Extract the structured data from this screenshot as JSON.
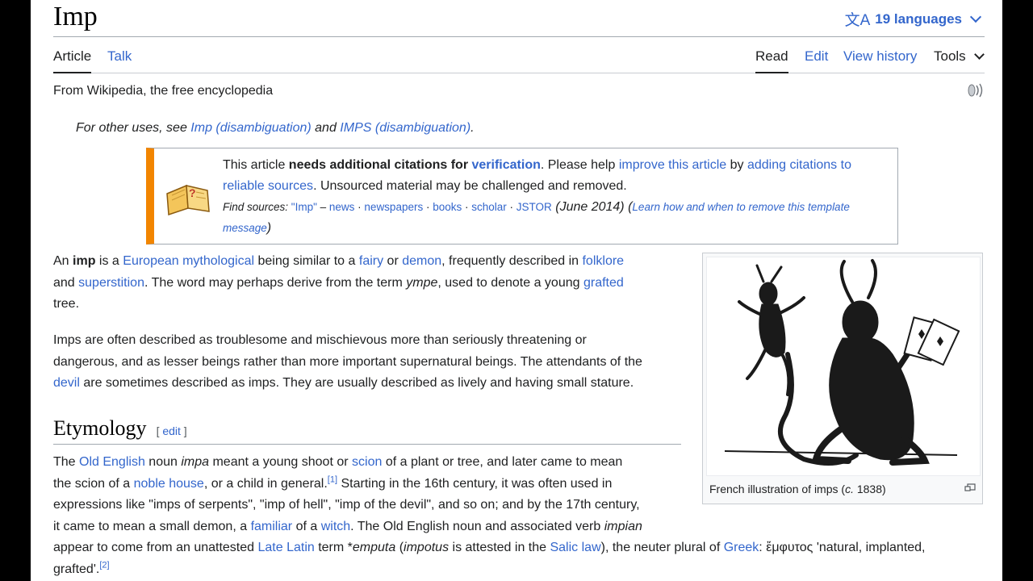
{
  "title": "Imp",
  "languages": "19 languages",
  "tabs": {
    "article": "Article",
    "talk": "Talk",
    "read": "Read",
    "edit": "Edit",
    "history": "View history",
    "tools": "Tools"
  },
  "tagline": "From Wikipedia, the free encyclopedia",
  "hatnote": {
    "prefix": "For other uses, see ",
    "link1": "Imp (disambiguation)",
    "mid": " and ",
    "link2": "IMPS (disambiguation)",
    "suffix": "."
  },
  "ambox": {
    "t1": "This article ",
    "bold": "needs additional citations for ",
    "verif": "verification",
    "t2": ". Please help ",
    "improve": "improve this article",
    "t3": " by ",
    "adding": "adding citations to reliable sources",
    "t4": ". Unsourced material may be challenged and removed.",
    "find": "Find sources: ",
    "q": "\"Imp\"",
    "dash": " – ",
    "news": "news",
    "dot": " · ",
    "newspapers": "newspapers",
    "books": "books",
    "scholar": "scholar",
    "jstor": "JSTOR",
    "date": " (June 2014)",
    "learn_open": " (",
    "learn": "Learn how and when to remove this template message",
    "learn_close": ")"
  },
  "p1": {
    "a": "An ",
    "imp": "imp",
    "b": " is a ",
    "euro": "European mythological",
    "c": " being similar to a ",
    "fairy": "fairy",
    "d": " or ",
    "demon": "demon",
    "e": ", frequently described in ",
    "folklore": "folklore",
    "f": "and ",
    "superstition": "superstition",
    "g": ". The word may perhaps derive from the term ",
    "ympe": "ympe",
    "h": ", used to denote a young ",
    "grafted": "grafted",
    "i": "tree."
  },
  "p2": {
    "l1": "Imps are often described as troublesome and mischievous more than seriously threatening or",
    "l2": "dangerous, and as lesser beings rather than more important supernatural beings. The attendants of the",
    "devil": "devil",
    "l3": " are sometimes described as imps. They are usually described as lively and having small stature."
  },
  "figure": {
    "caption_a": "French illustration of imps (",
    "circa": "c.",
    "caption_b": " 1838)"
  },
  "etymology": {
    "heading": "Etymology",
    "edit_open": "[ ",
    "edit": "edit",
    "edit_close": " ]",
    "a": "The ",
    "oldenglish": "Old English",
    "b": " noun ",
    "impa": "impa",
    "c": " meant a young shoot or ",
    "scion": "scion",
    "d": " of a plant or tree, and later came to mean",
    "e": "the scion of a ",
    "noble": "noble house",
    "f": ", or a child in general.",
    "ref1": "[1]",
    "g": " Starting in the 16th century, it was often used in",
    "h": "expressions like \"imps of serpents\", \"imp of hell\", \"imp of the devil\", and so on; and by the 17th century,",
    "i": "it came to mean a small demon, a ",
    "familiar": "familiar",
    "j": " of a ",
    "witch": "witch",
    "k": ". The Old English noun and associated verb ",
    "impian": "impian",
    "l": "appear to come from an unattested ",
    "latelatin": "Late Latin",
    "m": " term *",
    "emputa": "emputa",
    "n": " (",
    "impotus": "impotus",
    "o": " is attested in the ",
    "salic": "Salic law",
    "p": "), the neuter plural of ",
    "greek": "Greek",
    "q": ": ἔμφυτος 'natural, implanted,",
    "r": "grafted'.",
    "ref2": "[2]"
  }
}
